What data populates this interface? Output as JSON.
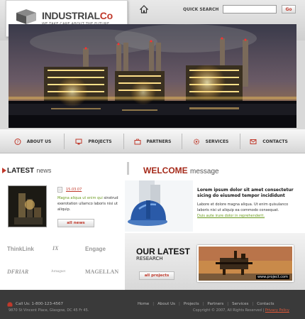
{
  "brand": {
    "title_main": "INDUSTRIAL",
    "title_co": "Co",
    "tagline": "WE TAKE CARE ABOUT THE FUTURE"
  },
  "header": {
    "quick_search_label": "QUICK SEARCH",
    "search_value": "",
    "search_button": "Go"
  },
  "nav": [
    {
      "label": "ABOUT US",
      "icon": "question-icon"
    },
    {
      "label": "PROJECTS",
      "icon": "monitor-icon"
    },
    {
      "label": "PARTNERS",
      "icon": "briefcase-icon"
    },
    {
      "label": "SERVICES",
      "icon": "gear-icon"
    },
    {
      "label": "CONTACTS",
      "icon": "envelope-icon"
    }
  ],
  "news": {
    "title_bold": "LATEST",
    "title_thin": "news",
    "date": "15.03.07",
    "text_highlight": "Magna aliqua ut enim qui",
    "text_rest": "sinstrud exerotation ullamco laboris nisi ut aliquip.",
    "button": "all news"
  },
  "partners": [
    "ThinkLink",
    "IX",
    "Engage",
    "DFRIAR",
    "Armagnet",
    "MAGELLAN"
  ],
  "welcome": {
    "title_bold": "WELCOME",
    "title_thin": "message",
    "heading": "Lorem ipsum dolor sit amet consectetur sicing do eiusmod tempor incididunt",
    "text": "Labore et dolore magna aliqua. Ut enim quisulanco laboris nisi ut aliquip ea commodo consequat.",
    "link": "Duis aute irure dolor in reprehenderit."
  },
  "research": {
    "title": "OUR LATEST",
    "subtitle": "RESEARCH",
    "button": "all projects",
    "url": "www.project.com"
  },
  "footer": {
    "phone": "Call Us: 1-800-123-4567",
    "address": "9870 St Vincent Place, Glasgow, DC 45 Fr 45.",
    "links": [
      "Home",
      "About Us",
      "Projects",
      "Partners",
      "Services",
      "Contacts"
    ],
    "separator": "|",
    "copyright": "Copyright © 2007, All Rights Reserved",
    "privacy": "Privacy Policy"
  },
  "colors": {
    "accent_red": "#c0392b",
    "accent_green": "#6a9a1e",
    "footer_bg": "#3a3a3a"
  }
}
